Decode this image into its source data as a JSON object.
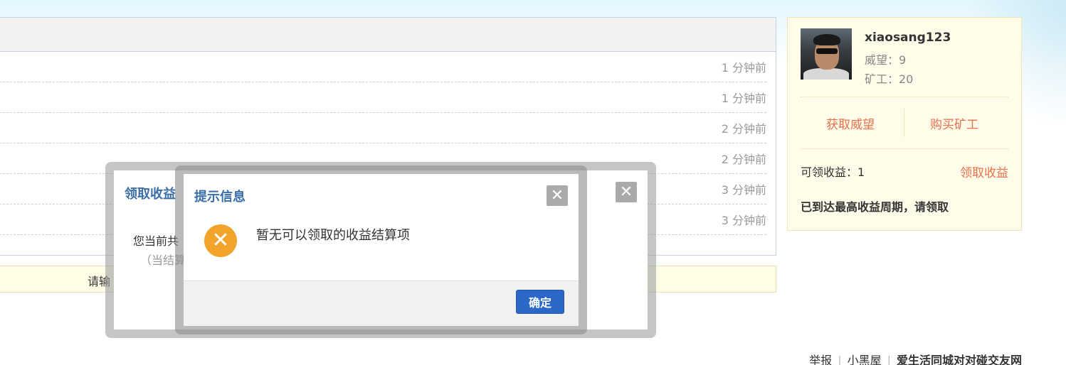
{
  "messages": [
    {
      "time": "1 分钟前"
    },
    {
      "time": "1 分钟前"
    },
    {
      "time": "2 分钟前"
    },
    {
      "time": "2 分钟前"
    },
    {
      "time": "3 分钟前"
    },
    {
      "time": "3 分钟前"
    }
  ],
  "input_bar": {
    "prompt": "请输"
  },
  "user": {
    "name": "xiaosang123",
    "prestige": "威望：9",
    "miners": "矿工：20",
    "get_prestige": "获取威望",
    "buy_miners": "购买矿工",
    "claimable": "可领收益：1",
    "claim_link": "领取收益",
    "notice": "已到达最高收益周期，请领取"
  },
  "footer": {
    "report": "举报",
    "blackroom": "小黑屋",
    "site": "爱生活同城对对碰交友网"
  },
  "outer_dialog": {
    "title": "领取收益",
    "line1": "您当前共",
    "line2": "（当结算",
    "close_glyph": "✕"
  },
  "inner_dialog": {
    "title": "提示信息",
    "message": "暂无可以领取的收益结算项",
    "ok_label": "确定",
    "close_glyph": "✕",
    "error_glyph": "✕"
  },
  "colors": {
    "accent_link": "#e8704b",
    "dialog_title": "#3a6ea8",
    "ok_button": "#2b67c6",
    "error_icon": "#f1a32a"
  }
}
